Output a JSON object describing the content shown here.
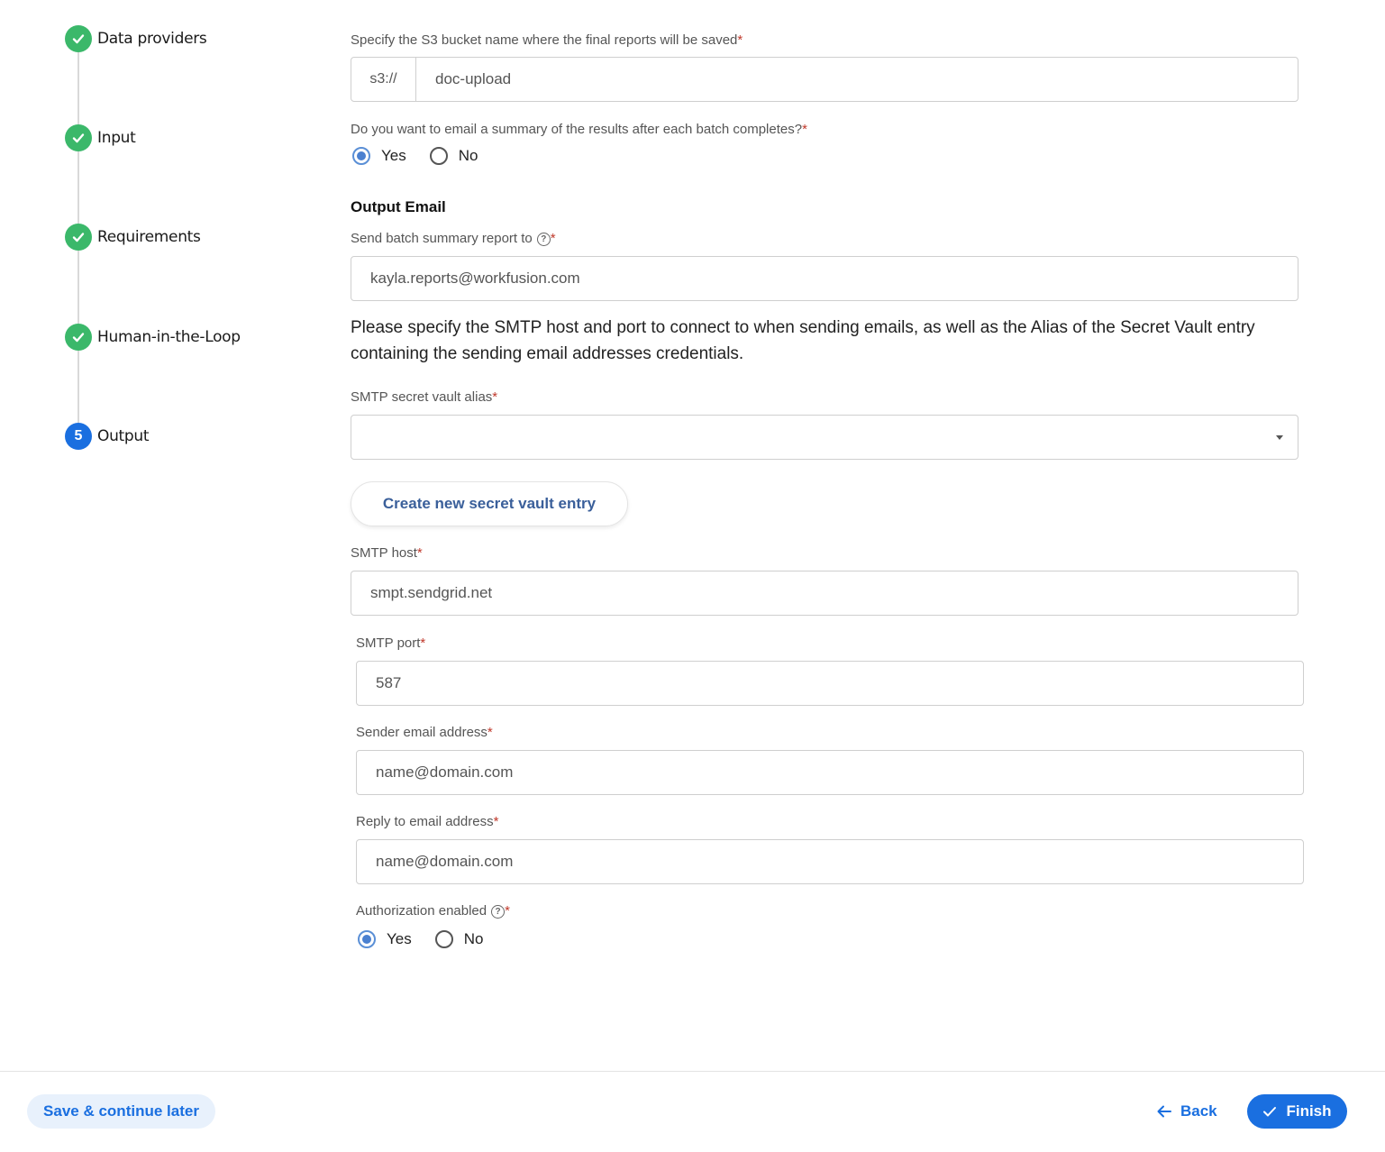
{
  "stepper": {
    "steps": [
      {
        "label": "Data providers",
        "state": "done"
      },
      {
        "label": "Input",
        "state": "done"
      },
      {
        "label": "Requirements",
        "state": "done"
      },
      {
        "label": "Human-in-the-Loop",
        "state": "done"
      },
      {
        "label": "Output",
        "state": "active",
        "number": "5"
      }
    ]
  },
  "s3": {
    "label": "Specify the S3 bucket name where the final reports will be saved",
    "prefix": "s3://",
    "value": "doc-upload"
  },
  "email_summary": {
    "question": "Do you want to email a summary of the results after each batch completes?",
    "yes": "Yes",
    "no": "No",
    "selected": "Yes"
  },
  "output_email": {
    "title": "Output Email",
    "send_to_label": "Send batch summary report to",
    "send_to_value": "kayla.reports@workfusion.com",
    "info_text": "Please specify the SMTP host and port to connect to when sending emails, as well as the Alias of the Secret Vault entry containing the sending email addresses credentials.",
    "vault_alias_label": "SMTP secret vault alias",
    "vault_alias_value": "",
    "create_vault_button": "Create new secret vault entry",
    "smtp_host_label": "SMTP host",
    "smtp_host_value": "smpt.sendgrid.net",
    "smtp_port_label": "SMTP port",
    "smtp_port_value": "587",
    "sender_label": "Sender email address",
    "sender_placeholder": "name@domain.com",
    "reply_label": "Reply to email address",
    "reply_placeholder": "name@domain.com",
    "auth_label": "Authorization enabled",
    "auth_yes": "Yes",
    "auth_no": "No",
    "auth_selected": "Yes"
  },
  "footer": {
    "save_label": "Save & continue later",
    "back_label": "Back",
    "finish_label": "Finish"
  },
  "required_mark": "*",
  "help_glyph": "?",
  "colors": {
    "accent": "#1a6fe0",
    "done": "#3bb86a",
    "required": "#c0392b"
  }
}
